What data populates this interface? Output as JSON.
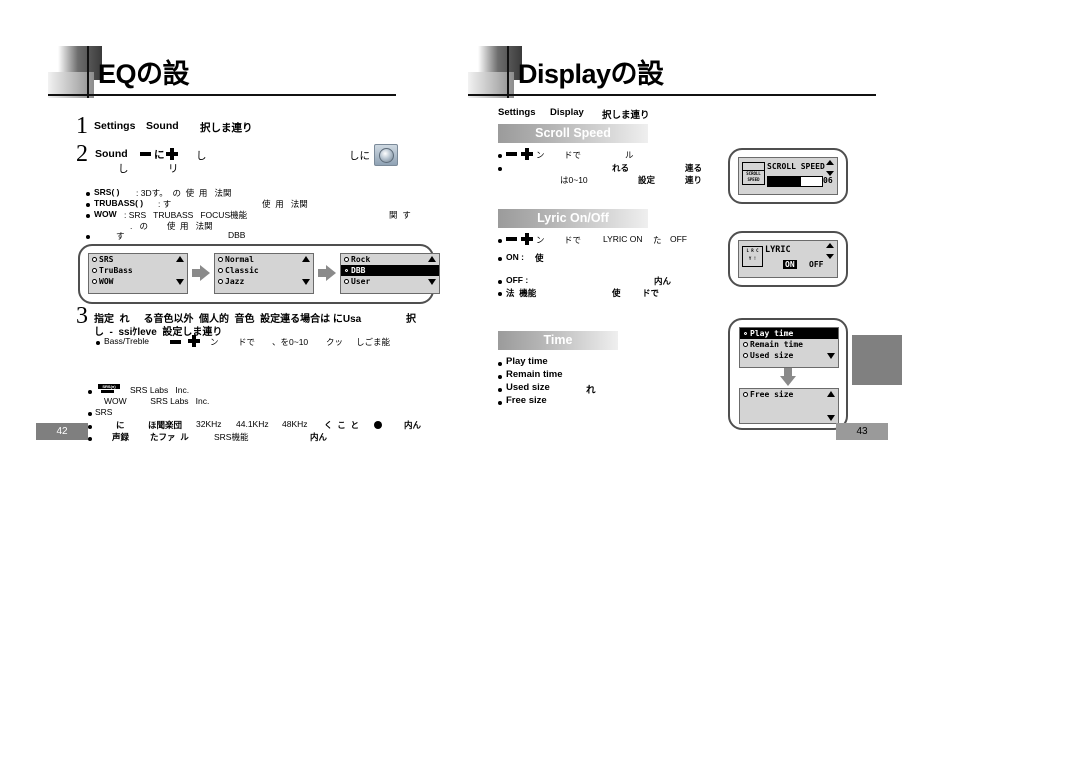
{
  "left": {
    "title": "EQの設",
    "page_number": "42",
    "steps": [
      {
        "num": "1",
        "line1_a": "Settings",
        "line1_b": "Sound",
        "line1_c": "択しま連り"
      },
      {
        "num": "2",
        "label": "Sound",
        "frag_ni": "に",
        "frag_shi_1": "し",
        "frag_shi_2": "し",
        "frag_ri": "リ",
        "frag_shini": "しに"
      },
      {
        "num": "3",
        "line1": "指定  れ     る音色以外  個人的  音色  設定連る場合は にUsa",
        "line1_tail": "択",
        "line2": "し  -  ssiｹleve  設定しま連り",
        "line3_label": "Bass/Treble",
        "line3_a": "ン",
        "line3_b": "ドで",
        "line3_c": "、を0~10",
        "line3_d": "クッ",
        "line3_e": "しごま能"
      }
    ],
    "notes": [
      {
        "label": "SRS( )",
        "text": ": 3Dす。  の  使  用   法関"
      },
      {
        "label": "TRUBASS( )",
        "text": ": す",
        "text2": "使  用   法関"
      },
      {
        "label": "WOW",
        "text": ": SRS   TRUBASS   FOCUS機能",
        "text2": "関  す"
      },
      {
        "cont": ".   の        使  用   法関"
      },
      {
        "text": "す",
        "text2": "DBB"
      }
    ],
    "footnotes": [
      {
        "text": "SRS Labs   Inc.",
        "text2": "WOW          SRS Labs   Inc."
      },
      {
        "text": "SRS"
      },
      {
        "a": "に",
        "b": "ほ聞楽団",
        "c": "32KHz",
        "d": "44.1KHz",
        "e": "48KHz",
        "f": "く  こ  と",
        "g": "内ん"
      },
      {
        "a": "声録",
        "b": "たファ  ル",
        "c": "SRS機能",
        "d": "内ん"
      }
    ],
    "lcds": [
      {
        "rows": [
          {
            "label": "SRS",
            "selected": false,
            "filled": false
          },
          {
            "label": "TruBass",
            "selected": false,
            "filled": false
          },
          {
            "label": "WOW",
            "selected": false,
            "filled": false
          }
        ]
      },
      {
        "rows": [
          {
            "label": "Normal",
            "selected": false,
            "filled": false
          },
          {
            "label": "Classic",
            "selected": false,
            "filled": false
          },
          {
            "label": "Jazz",
            "selected": false,
            "filled": false
          }
        ]
      },
      {
        "rows": [
          {
            "label": "Rock",
            "selected": false,
            "filled": false
          },
          {
            "label": "DBB",
            "selected": true,
            "filled": true
          },
          {
            "label": "User",
            "selected": false,
            "filled": false
          }
        ]
      }
    ]
  },
  "right": {
    "title": "Displayの設",
    "page_number": "43",
    "breadcrumb": {
      "a": "Settings",
      "b": "Display",
      "c": "択しま連り"
    },
    "sections": [
      {
        "id": "scroll-speed",
        "header": "Scroll Speed",
        "lines": [
          {
            "a": "ン",
            "b": "ドで",
            "c": "ル"
          },
          {
            "a": "れる",
            "b": "連る"
          },
          {
            "a": "は0~10",
            "b": "設定",
            "c": "連り"
          }
        ]
      },
      {
        "id": "lyric-on-off",
        "header": "Lyric On/Off",
        "lines": [
          {
            "a": "ン",
            "b": "ドで",
            "c": "LYRIC ON",
            "d": "た",
            "e": "OFF"
          },
          {
            "a": "ON :",
            "b": "使"
          },
          {
            "a": "OFF :",
            "b": "内ん"
          },
          {
            "a": "法  機能",
            "b": "使",
            "c": "ドで"
          }
        ]
      },
      {
        "id": "time",
        "header": "Time",
        "items": [
          {
            "label": "Play time"
          },
          {
            "label": "Remain time"
          },
          {
            "label": "Used size",
            "extra": "れ"
          },
          {
            "label": "Free size"
          }
        ]
      }
    ],
    "lcd_scroll_speed": {
      "badge_line1": "SCROLL",
      "badge_line2": "SPEED",
      "title": "SCROLL SPEED",
      "value": "06",
      "bar_fill_percent": 62
    },
    "lcd_lyric": {
      "badge_line1": "L R C",
      "badge_line2": "Y !",
      "title": "LYRIC",
      "option_on": "ON",
      "option_off": "OFF",
      "selected": "ON"
    },
    "lcd_time_top": {
      "rows": [
        {
          "label": "Play time",
          "selected": true,
          "filled": true
        },
        {
          "label": "Remain time",
          "selected": false,
          "filled": false
        },
        {
          "label": "Used size",
          "selected": false,
          "filled": false
        }
      ]
    },
    "lcd_time_bottom": {
      "rows": [
        {
          "label": "Free size",
          "selected": false,
          "filled": false
        }
      ]
    }
  },
  "colors": {
    "lcd_bg": "#d4d4d4",
    "bar_gradient_start": "#9b9b9b",
    "bar_gradient_end": "#efefef",
    "page_plate": "#7f7f7f",
    "gray_block": "#808080"
  }
}
